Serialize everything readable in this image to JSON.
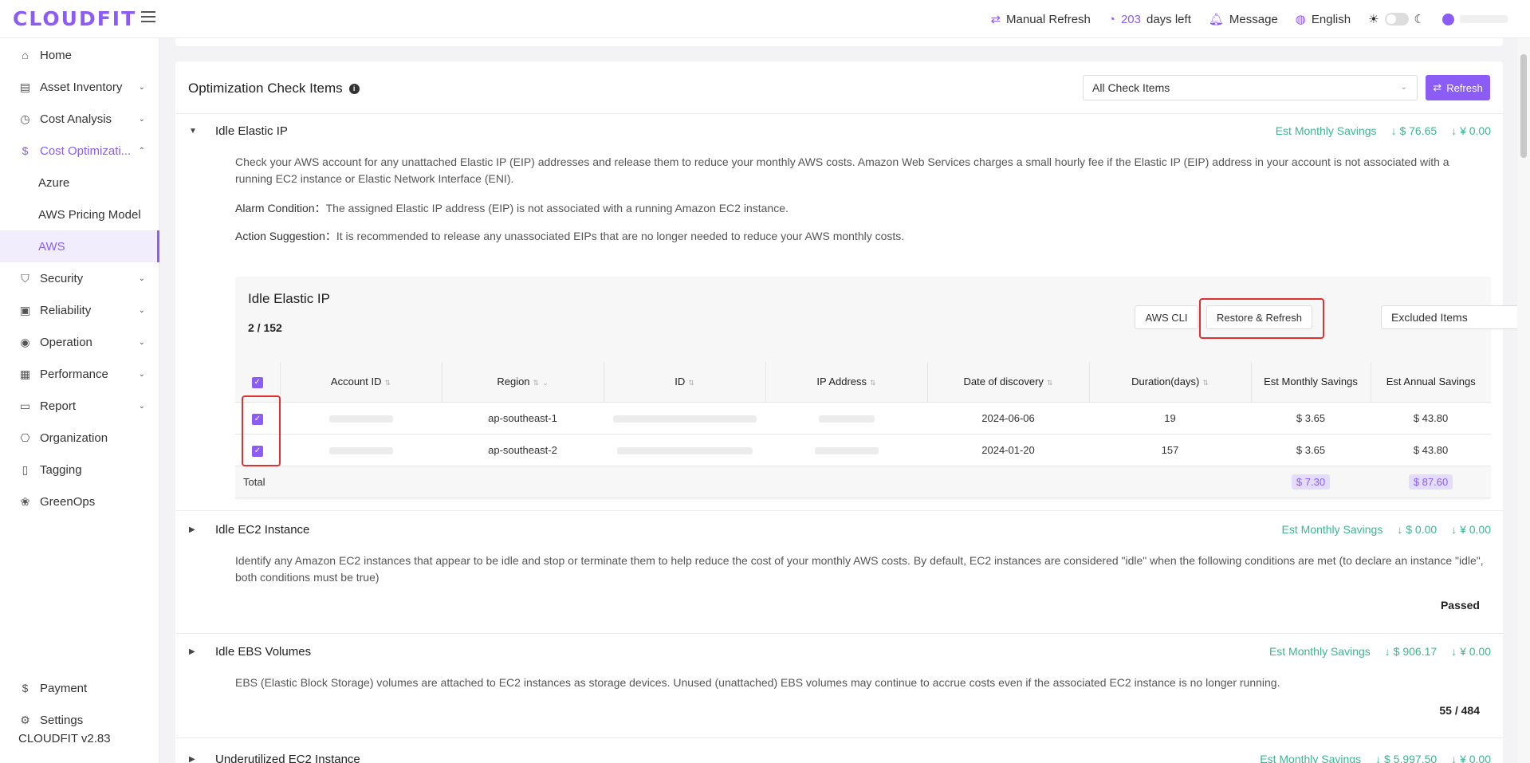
{
  "app": {
    "logo": "CLOUDFIT",
    "version": "CLOUDFIT v2.83"
  },
  "header": {
    "manual_refresh": "Manual Refresh",
    "days_num": "203",
    "days_text": "days left",
    "message": "Message",
    "language": "English"
  },
  "sidebar": {
    "items": [
      {
        "label": "Home",
        "icon": "home-icon"
      },
      {
        "label": "Asset Inventory",
        "icon": "inventory-icon"
      },
      {
        "label": "Cost Analysis",
        "icon": "gauge-icon"
      },
      {
        "label": "Cost Optimizati...",
        "icon": "dollar-icon"
      },
      {
        "label": "Azure"
      },
      {
        "label": "AWS Pricing Model"
      },
      {
        "label": "AWS"
      },
      {
        "label": "Security",
        "icon": "shield-icon"
      },
      {
        "label": "Reliability",
        "icon": "reliability-icon"
      },
      {
        "label": "Operation",
        "icon": "eye-icon"
      },
      {
        "label": "Performance",
        "icon": "performance-icon"
      },
      {
        "label": "Report",
        "icon": "report-icon"
      },
      {
        "label": "Organization",
        "icon": "organization-icon"
      },
      {
        "label": "Tagging",
        "icon": "tag-icon"
      },
      {
        "label": "GreenOps",
        "icon": "leaf-icon"
      },
      {
        "label": "Payment",
        "icon": "payment-icon"
      },
      {
        "label": "Settings",
        "icon": "gear-icon"
      }
    ]
  },
  "main": {
    "title": "Optimization Check Items",
    "filter_value": "All Check Items",
    "refresh_label": "Refresh",
    "sections": [
      {
        "title": "Idle Elastic IP",
        "savings_label": "Est Monthly Savings",
        "savings_usd": "$ 76.65",
        "savings_cny": "¥ 0.00",
        "desc": "Check your AWS account for any unattached Elastic IP (EIP) addresses and release them to reduce your monthly AWS costs. Amazon Web Services charges a small hourly fee if the Elastic IP (EIP) address in your account is not associated with a running EC2 instance or Elastic Network Interface (ENI).",
        "alarm_label": "Alarm Condition：",
        "alarm_text": "The assigned Elastic IP address (EIP) is not associated with a running Amazon EC2 instance.",
        "action_label": "Action Suggestion：",
        "action_text": "It is recommended to release any unassociated EIPs that are no longer needed to reduce your AWS monthly costs."
      },
      {
        "title": "Idle EC2 Instance",
        "savings_label": "Est Monthly Savings",
        "savings_usd": "$ 0.00",
        "savings_cny": "¥ 0.00",
        "desc": "Identify any Amazon EC2 instances that appear to be idle and stop or terminate them to help reduce the cost of your monthly AWS costs. By default, EC2 instances are considered \"idle\" when the following conditions are met (to declare an instance \"idle\", both conditions must be true)",
        "status": "Passed"
      },
      {
        "title": "Idle EBS Volumes",
        "savings_label": "Est Monthly Savings",
        "savings_usd": "$ 906.17",
        "savings_cny": "¥ 0.00",
        "desc": "EBS (Elastic Block Storage) volumes are attached to EC2 instances as storage devices. Unused (unattached) EBS volumes may continue to accrue costs even if the associated EC2 instance is no longer running.",
        "status": "55 / 484"
      },
      {
        "title": "Underutilized EC2 Instance",
        "savings_label": "Est Monthly Savings",
        "savings_usd": "$ 5,997.50",
        "savings_cny": "¥ 0.00"
      }
    ],
    "panel": {
      "title": "Idle Elastic IP",
      "count": "2 / 152",
      "aws_cli": "AWS CLI",
      "restore_refresh": "Restore & Refresh",
      "excluded": "Excluded Items",
      "columns": [
        "Account ID",
        "Region",
        "ID",
        "IP Address",
        "Date of discovery",
        "Duration(days)",
        "Est Monthly Savings",
        "Est Annual Savings"
      ],
      "rows": [
        {
          "region": "ap-southeast-1",
          "date": "2024-06-06",
          "duration": "19",
          "monthly": "$ 3.65",
          "annual": "$ 43.80"
        },
        {
          "region": "ap-southeast-2",
          "date": "2024-01-20",
          "duration": "157",
          "monthly": "$ 3.65",
          "annual": "$ 43.80"
        }
      ],
      "total_label": "Total",
      "total_monthly": "$ 7.30",
      "total_annual": "$ 87.60"
    }
  },
  "colors": {
    "accent": "#8b5cf6",
    "savings": "#3cb591",
    "highlight": "#e03131"
  }
}
